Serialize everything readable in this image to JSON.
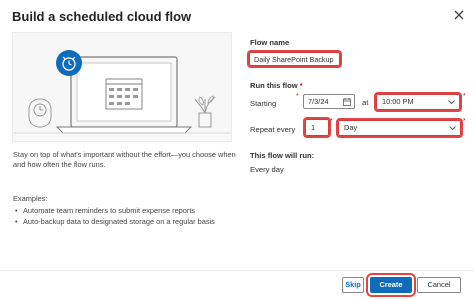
{
  "dialog": {
    "title": "Build a scheduled cloud flow"
  },
  "left": {
    "description": "Stay on top of what's important without the effort—you choose when and how often the flow runs.",
    "examples_label": "Examples:",
    "examples": [
      "Automate team reminders to submit expense reports",
      "Auto-backup data to designated storage on a regular basis"
    ]
  },
  "form": {
    "flow_name_label": "Flow name",
    "flow_name_value": "Daily SharePoint Backup",
    "run_label": "Run this flow",
    "required_marker": "*",
    "starting_label": "Starting",
    "start_date": "7/3/24",
    "at_label": "at",
    "start_time": "10:00 PM",
    "repeat_label": "Repeat every",
    "repeat_interval": "1",
    "repeat_unit": "Day",
    "summary_label": "This flow will run:",
    "summary_value": "Every day"
  },
  "footer": {
    "skip": "Skip",
    "create": "Create",
    "cancel": "Cancel"
  },
  "colors": {
    "accent": "#0f6cbd",
    "highlight": "#e04444"
  }
}
